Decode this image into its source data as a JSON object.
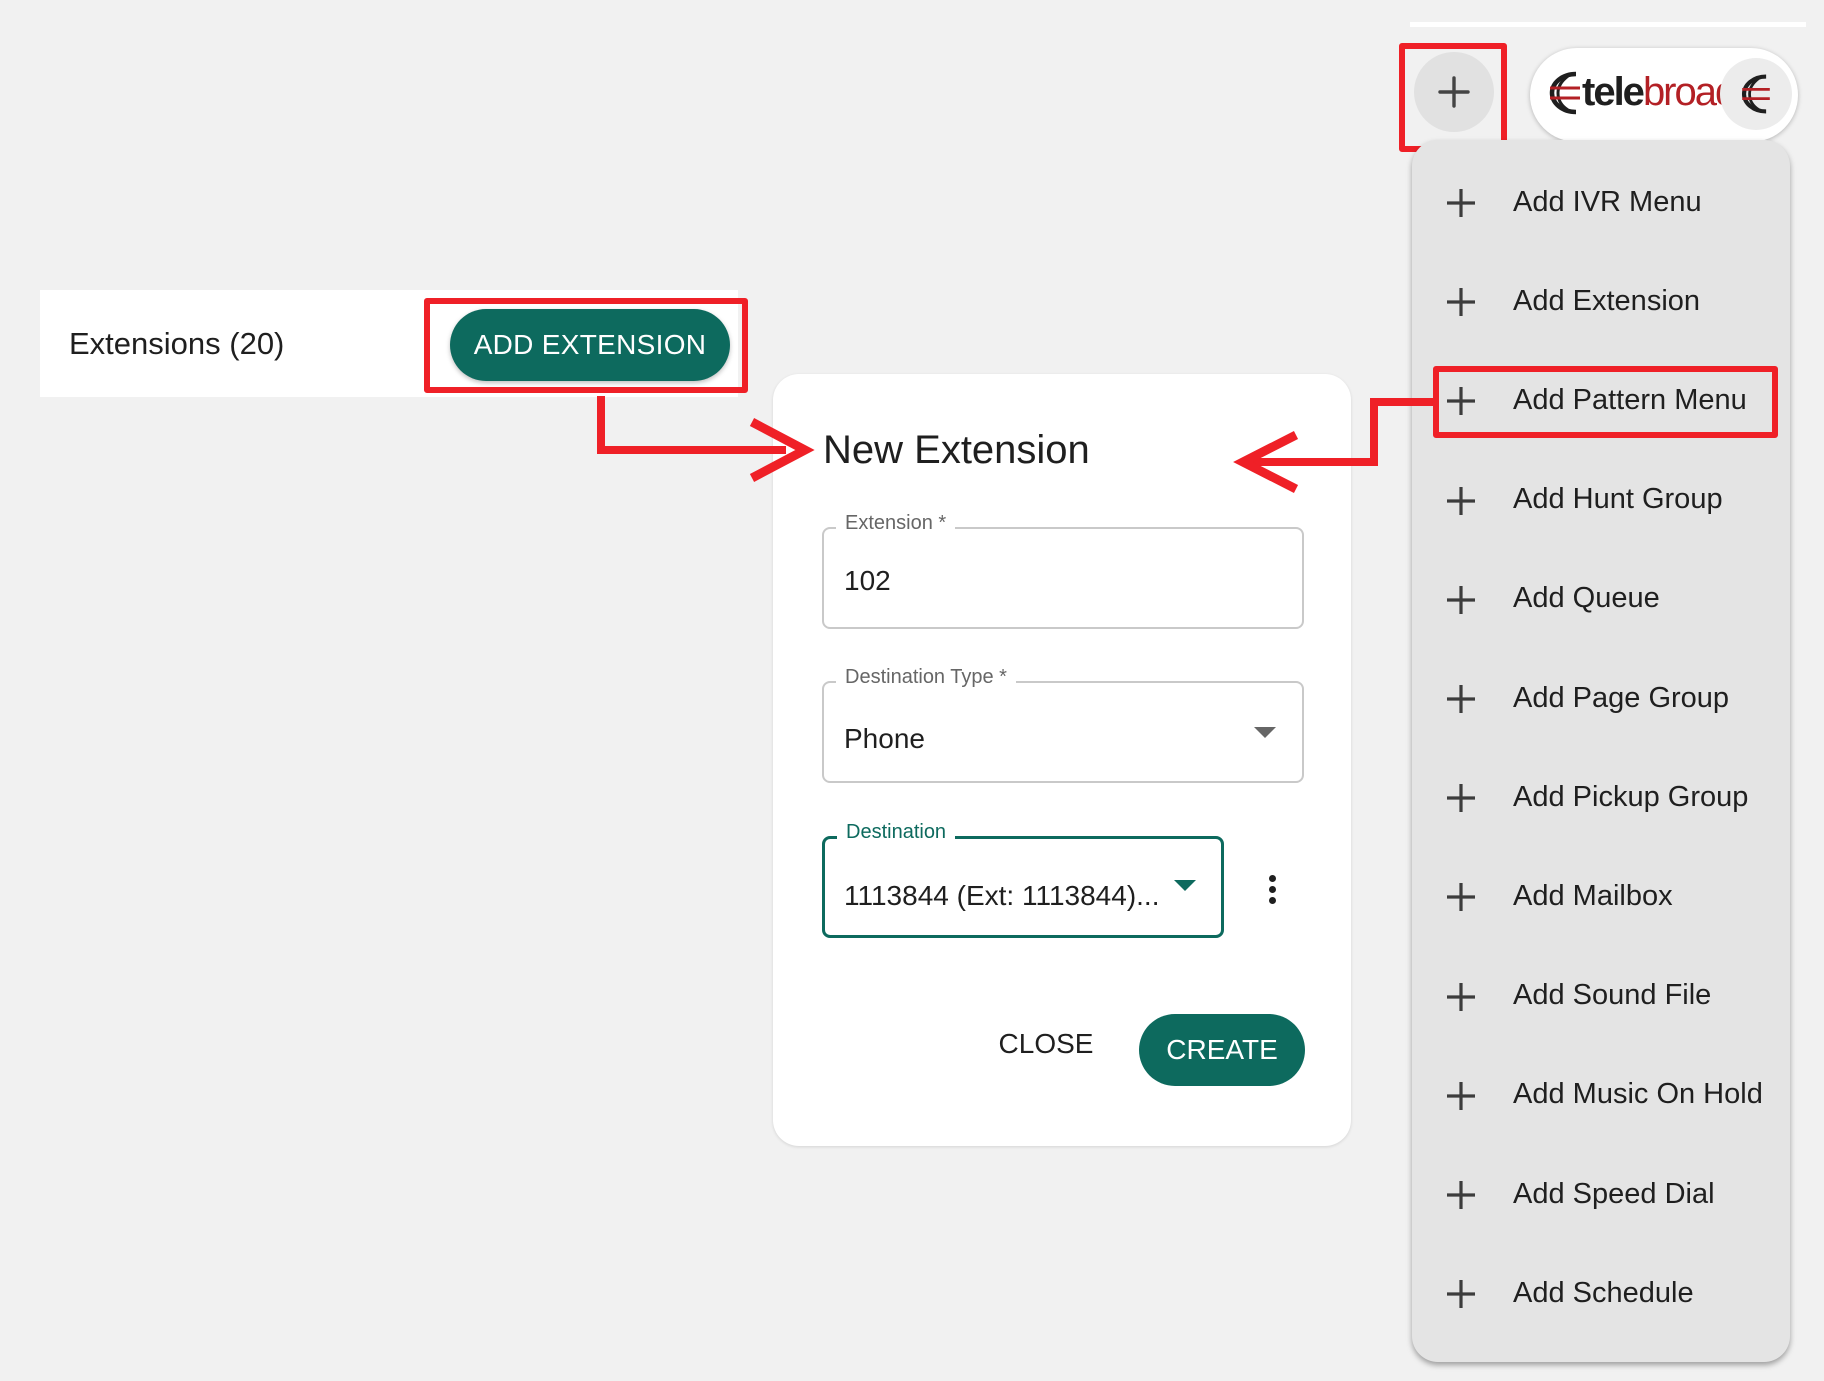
{
  "extensions": {
    "title": "Extensions (20)",
    "add_button_label": "ADD EXTENSION"
  },
  "dialog": {
    "title": "New Extension",
    "fields": {
      "extension": {
        "label": "Extension *",
        "value": "102"
      },
      "destination_type": {
        "label": "Destination Type *",
        "value": "Phone"
      },
      "destination": {
        "label": "Destination",
        "value": "1113844 (Ext: 1113844)..."
      }
    },
    "close_label": "CLOSE",
    "create_label": "CREATE"
  },
  "header": {
    "logo": {
      "text_bold": "tele",
      "text_regular": "broad"
    }
  },
  "add_menu": {
    "items": [
      {
        "label": "Add IVR Menu"
      },
      {
        "label": "Add Extension"
      },
      {
        "label": "Add Pattern Menu"
      },
      {
        "label": "Add Hunt Group"
      },
      {
        "label": "Add Queue"
      },
      {
        "label": "Add Page Group"
      },
      {
        "label": "Add Pickup Group"
      },
      {
        "label": "Add Mailbox"
      },
      {
        "label": "Add Sound File"
      },
      {
        "label": "Add Music On Hold"
      },
      {
        "label": "Add Speed Dial"
      },
      {
        "label": "Add Schedule"
      }
    ]
  },
  "colors": {
    "primary": "#0d6a5e",
    "highlight": "#ef2027",
    "background": "#f1f1f1",
    "logo_red": "#b32025"
  }
}
